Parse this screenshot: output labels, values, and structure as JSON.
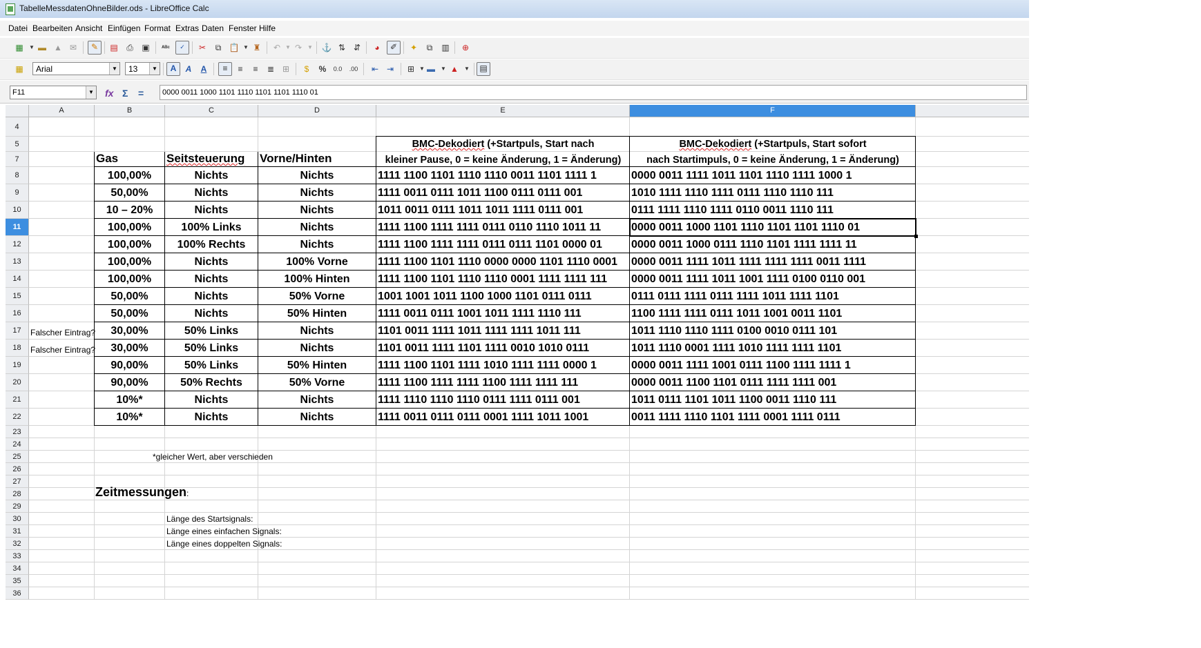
{
  "window": {
    "title": "TabelleMessdatenOhneBilder.ods - LibreOffice Calc"
  },
  "menu": [
    "Datei",
    "Bearbeiten",
    "Ansicht",
    "Einfügen",
    "Format",
    "Extras",
    "Daten",
    "Fenster",
    "Hilfe"
  ],
  "toolbar_format": {
    "font_name": "Arial",
    "font_size": "13"
  },
  "formula_bar": {
    "cell_ref": "F11",
    "formula": "0000 0011 1000 1101 1110 1101 1101 1110 01"
  },
  "columns": [
    "A",
    "B",
    "C",
    "D",
    "E",
    "F"
  ],
  "selected_cell": {
    "column": "F",
    "row": "11"
  },
  "rows": [
    "4",
    "5",
    "7",
    "8",
    "9",
    "10",
    "11",
    "12",
    "13",
    "14",
    "15",
    "16",
    "17",
    "18",
    "19",
    "20",
    "21",
    "22",
    "23",
    "24",
    "25",
    "26",
    "27",
    "28",
    "29",
    "30",
    "31",
    "32",
    "33",
    "34",
    "35",
    "36"
  ],
  "sheet": {
    "headers": {
      "gas": "Gas",
      "seitsteuerung": "Seitsteuerung",
      "vorne_hinten": "Vorne/Hinten",
      "bmc_e_line1_word": "BMC-Dekodiert",
      "bmc_e_line1_rest": " (+Startpuls, Start nach",
      "bmc_e_line2": "kleiner Pause, 0 = keine Änderung, 1 = Änderung)",
      "bmc_f_line1_word": "BMC-Dekodiert",
      "bmc_f_line1_rest": " (+Startpuls, Start sofort",
      "bmc_f_line2": "nach Startimpuls, 0 = keine Änderung, 1 = Änderung)"
    },
    "data_rows": [
      {
        "a": "",
        "gas": "100,00%",
        "seit": "Nichts",
        "vh": "Nichts",
        "e": "1111 1100 1101 1110 1110 0011 1101 1111 1",
        "f": "0000 0011 1111 1011 1101 1110 1111 1000 1"
      },
      {
        "a": "",
        "gas": "50,00%",
        "seit": "Nichts",
        "vh": "Nichts",
        "e": "1111 0011 0111 1011 1100 0111 0111 001",
        "f": "1010 1111 1110 1111 0111 1110 1110 111"
      },
      {
        "a": "",
        "gas": "10 – 20%",
        "seit": "Nichts",
        "vh": "Nichts",
        "e": "1011 0011 0111 1011 1011 1111 0111 001",
        "f": "0111 1111 1110 1111 0110 0011 1110 111"
      },
      {
        "a": "",
        "gas": "100,00%",
        "seit": "100% Links",
        "vh": "Nichts",
        "e": "1111 1100 1111 1111 0111 0110 1110 1011 11",
        "f": "0000 0011 1000 1101 1110 1101 1101 1110 01"
      },
      {
        "a": "",
        "gas": "100,00%",
        "seit": "100% Rechts",
        "vh": "Nichts",
        "e": "1111 1100 1111 1111 0111 0111 1101 0000 01",
        "f": "0000 0011 1000 0111 1110 1101 1111 1111 11"
      },
      {
        "a": "",
        "gas": "100,00%",
        "seit": "Nichts",
        "vh": "100% Vorne",
        "e": "1111 1100 1101 1110 0000 0000 1101 1110 0001",
        "f": "0000 0011 1111 1011 1111 1111 1111 0011 1111"
      },
      {
        "a": "",
        "gas": "100,00%",
        "seit": "Nichts",
        "vh": "100% Hinten",
        "e": "1111 1100 1101 1110 1110 0001 1111 1111 111",
        "f": "0000 0011 1111 1011 1001 1111 0100 0110 001"
      },
      {
        "a": "",
        "gas": "50,00%",
        "seit": "Nichts",
        "vh": "50% Vorne",
        "e": "1001 1001 1011 1100 1000 1101 0111 0111",
        "f": "0111 0111 1111 0111 1111 1011 1111 1101"
      },
      {
        "a": "",
        "gas": "50,00%",
        "seit": "Nichts",
        "vh": "50% Hinten",
        "e": "1111 0011 0111 1001 1011 1111 1110 111",
        "f": "1100 1111 1111 0111 1011 1001 0011 1101"
      },
      {
        "a": "Falscher Eintrag?",
        "gas": "30,00%",
        "seit": "50% Links",
        "vh": "Nichts",
        "e": "1101 0011 1111 1011 1111 1111 1011 111",
        "f": "1011 1110 1110 1111 0100 0010 0111 101"
      },
      {
        "a": "Falscher Eintrag?",
        "gas": "30,00%",
        "seit": "50% Links",
        "vh": "Nichts",
        "e": "1101 0011 1111 1101 1111 0010 1010 0111",
        "f": "1011 1110 0001 1111 1010 1111 1111 1101"
      },
      {
        "a": "",
        "gas": "90,00%",
        "seit": "50% Links",
        "vh": "50% Hinten",
        "e": "1111 1100 1101 1111 1010 1111 1111 0000 1",
        "f": "0000 0011 1111 1001 0111 1100 1111 1111 1"
      },
      {
        "a": "",
        "gas": "90,00%",
        "seit": "50% Rechts",
        "vh": "50% Vorne",
        "e": "1111 1100 1111 1111 1100 1111 1111 111",
        "f": "0000 0011 1100 1101 0111 1111 1111 001"
      },
      {
        "a": "",
        "gas": "10%*",
        "seit": "Nichts",
        "vh": "Nichts",
        "e": "1111 1110 1110 1110 0111 1111 0111 001",
        "f": "1011 0111 1101 1011 1100 0011 1110 111"
      },
      {
        "a": "",
        "gas": "10%*",
        "seit": "Nichts",
        "vh": "Nichts",
        "e": "1111 0011 0111 0111 0001 1111 1011 1001",
        "f": "0011 1111 1110 1101 1111 0001 1111 0111"
      }
    ],
    "footnote": "*gleicher Wert, aber verschieden",
    "zeitmessungen": "Zeitmessungen",
    "zeitmessungen_colon": ":",
    "labels": [
      "Länge des Startsignals:",
      "Länge eines einfachen Signals:",
      "Länge eines doppelten Signals:"
    ]
  }
}
